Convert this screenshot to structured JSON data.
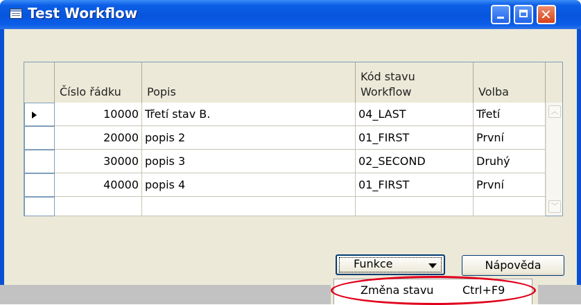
{
  "window": {
    "title": "Test Workflow",
    "icon": "form-icon"
  },
  "caption_buttons": [
    "minimize-icon",
    "maximize-icon",
    "close-icon"
  ],
  "grid": {
    "columns": {
      "line_no": "Číslo řádku",
      "description": "Popis",
      "state_code_1": "Kód stavu",
      "state_code_2": "Workflow",
      "option": "Volba"
    },
    "rows": [
      {
        "line_no": "10000",
        "description": "Třetí stav B.",
        "state_code": "04_LAST",
        "option": "Třetí",
        "current": true
      },
      {
        "line_no": "20000",
        "description": "popis 2",
        "state_code": "01_FIRST",
        "option": "První",
        "current": false
      },
      {
        "line_no": "30000",
        "description": "popis 3",
        "state_code": "02_SECOND",
        "option": "Druhý",
        "current": false
      },
      {
        "line_no": "40000",
        "description": "popis 4",
        "state_code": "01_FIRST",
        "option": "První",
        "current": false
      },
      {
        "line_no": "",
        "description": "",
        "state_code": "",
        "option": "",
        "current": false
      }
    ]
  },
  "buttons": {
    "functions": "Funkce",
    "help": "Nápověda"
  },
  "menu": {
    "item_label": "Změna stavu",
    "item_shortcut": "Ctrl+F9"
  },
  "colors": {
    "titlebar": "#0855dd",
    "highlight_ellipse": "#e0001b",
    "dialog_bg": "#ece9d8"
  }
}
